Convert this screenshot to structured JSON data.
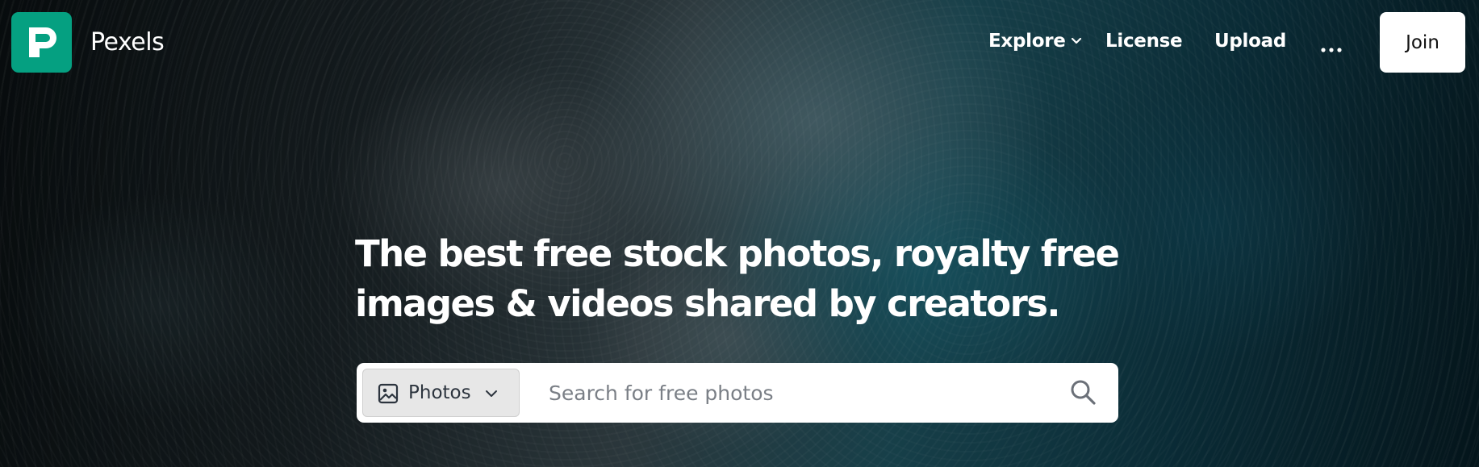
{
  "nav": {
    "brand": "Pexels",
    "links": {
      "explore": "Explore",
      "license": "License",
      "upload": "Upload"
    },
    "join_label": "Join"
  },
  "hero": {
    "headline_line1": "The best free stock photos, royalty free",
    "headline_line2": "images & videos shared by creators."
  },
  "search": {
    "type_label": "Photos",
    "placeholder": "Search for free photos",
    "value": ""
  },
  "colors": {
    "brand": "#05a081",
    "text_on_dark": "#ffffff",
    "button_bg": "#ffffff"
  },
  "icons": {
    "logo": "pexels-logo",
    "explore_dropdown": "chevron-down-icon",
    "more": "more-horizontal-icon",
    "type": "image-icon",
    "type_dropdown": "chevron-down-icon",
    "search": "search-icon"
  }
}
